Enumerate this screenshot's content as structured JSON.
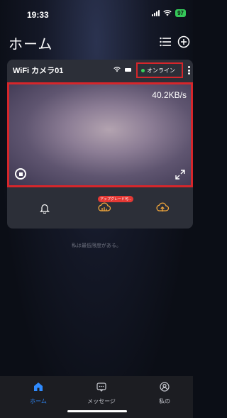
{
  "status_bar": {
    "time": "19:33",
    "battery": "97"
  },
  "header": {
    "title": "ホーム",
    "list_icon": "list-icon",
    "add_icon": "plus-circle-icon"
  },
  "device": {
    "name": "WiFi カメラ01",
    "status": "オンライン",
    "speed": "40.2KB/s",
    "upgrade_badge": "アップグレード可..."
  },
  "note": "私は最低限度がある。",
  "tabs": [
    {
      "label": "ホーム",
      "icon": "home-icon",
      "active": true
    },
    {
      "label": "メッセージ",
      "icon": "message-icon",
      "active": false
    },
    {
      "label": "私の",
      "icon": "profile-icon",
      "active": false
    }
  ],
  "colors": {
    "accent": "#2f8bff",
    "highlight": "#d6262b",
    "online": "#3ad15c",
    "cloud": "#f2a73b"
  }
}
